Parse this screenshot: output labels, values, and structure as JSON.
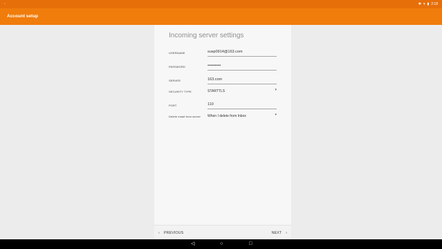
{
  "status_bar": {
    "time": "2:18",
    "icons": [
      "bluetooth-icon",
      "wifi-icon",
      "battery-icon"
    ]
  },
  "app_bar": {
    "title": "Account setup"
  },
  "form": {
    "title": "Incoming server settings",
    "username": {
      "label": "USERNAME",
      "value": "susp0914@163.com"
    },
    "password": {
      "label": "PASSWORD",
      "value": "••••••••••"
    },
    "server": {
      "label": "SERVER",
      "value": "163.com"
    },
    "security_type": {
      "label": "SECURITY TYPE",
      "value": "STARTTLS"
    },
    "port": {
      "label": "PORT",
      "value": "110"
    },
    "delete_email": {
      "label": "Delete email from server",
      "value": "When I delete from Inbox"
    }
  },
  "footer": {
    "previous_label": "PREVIOUS",
    "next_label": "NEXT"
  },
  "nav": {
    "icons": [
      "back-icon",
      "home-icon",
      "recents-icon"
    ]
  },
  "colors": {
    "accent": "#f07c0c",
    "status": "#e66f0a",
    "nav": "#000000"
  }
}
